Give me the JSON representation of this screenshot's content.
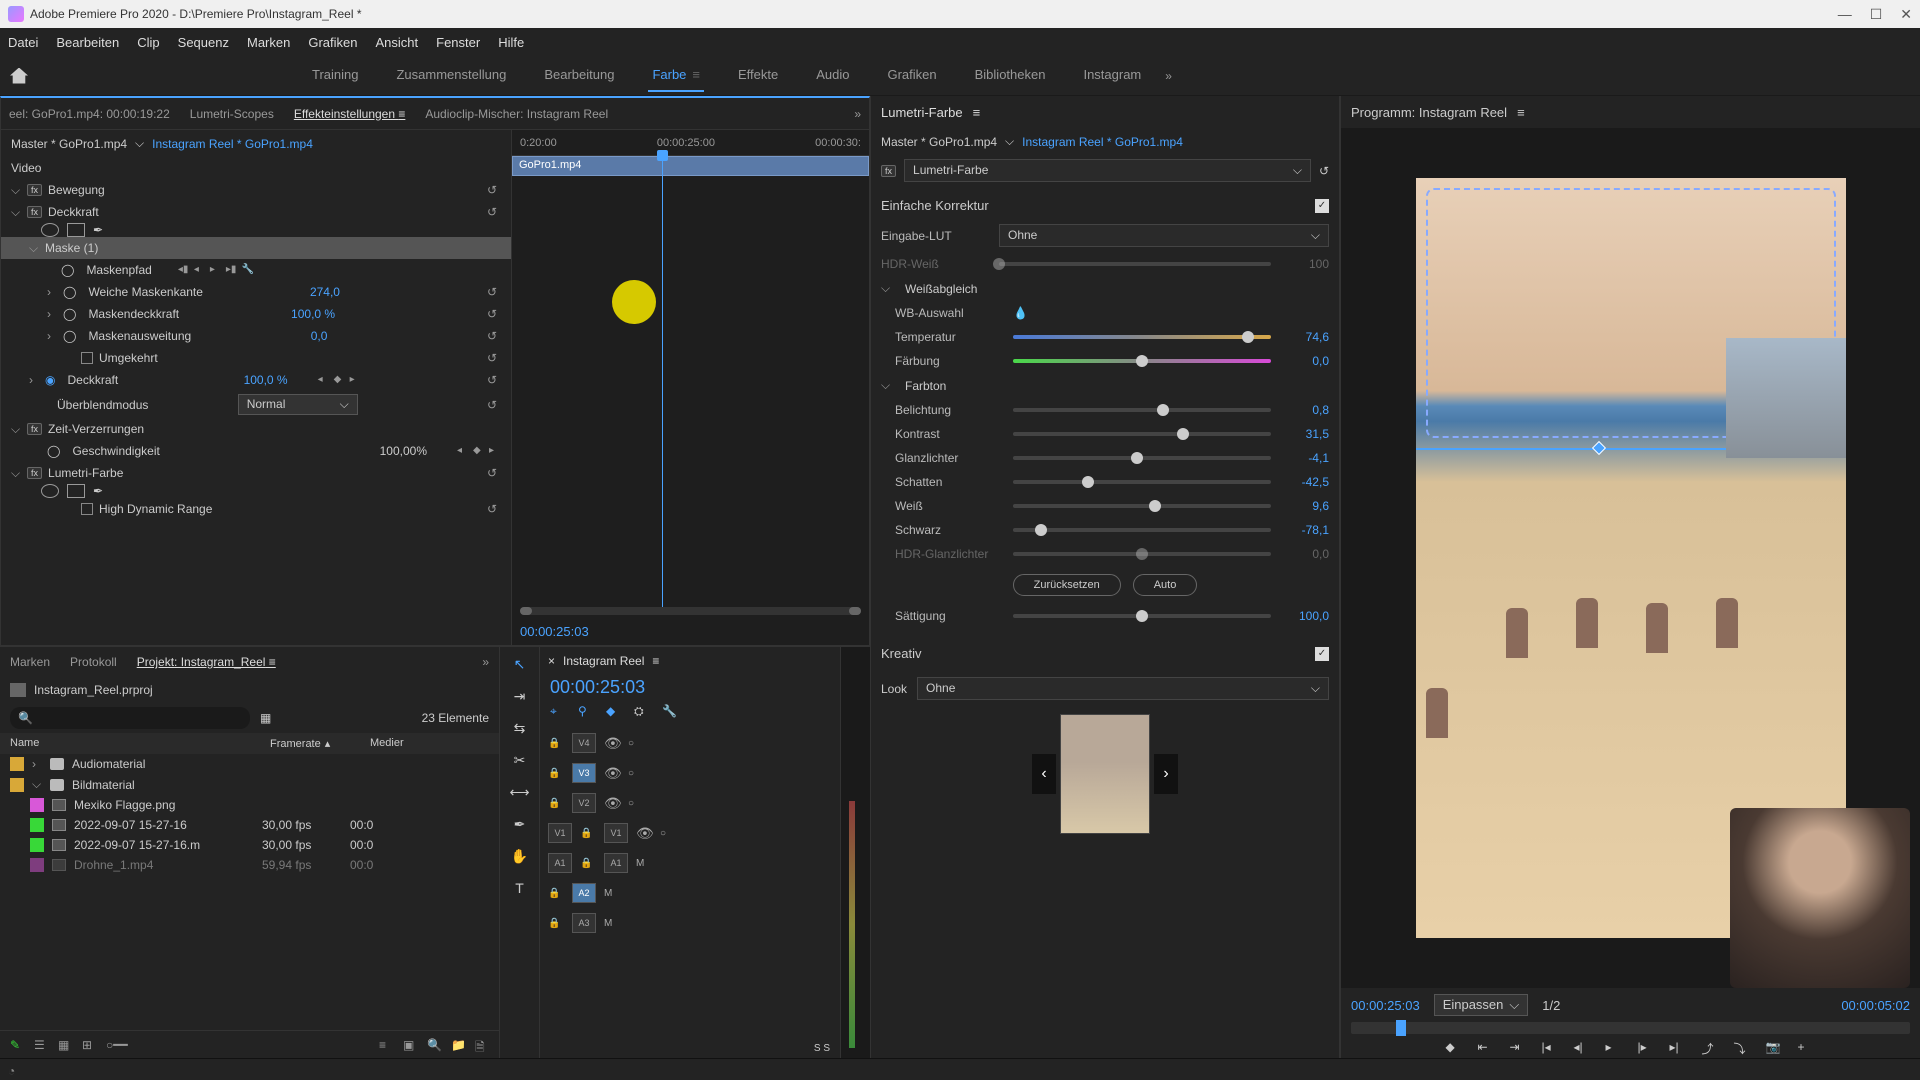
{
  "window": {
    "title": "Adobe Premiere Pro 2020 - D:\\Premiere Pro\\Instagram_Reel *"
  },
  "menu": [
    "Datei",
    "Bearbeiten",
    "Clip",
    "Sequenz",
    "Marken",
    "Grafiken",
    "Ansicht",
    "Fenster",
    "Hilfe"
  ],
  "workspaces": {
    "items": [
      "Training",
      "Zusammenstellung",
      "Bearbeitung",
      "Farbe",
      "Effekte",
      "Audio",
      "Grafiken",
      "Bibliotheken",
      "Instagram"
    ],
    "active": "Farbe"
  },
  "source_tabs": {
    "items": [
      "eel: GoPro1.mp4: 00:00:19:22",
      "Lumetri-Scopes",
      "Effekteinstellungen",
      "Audioclip-Mischer: Instagram Reel"
    ],
    "active": "Effekteinstellungen"
  },
  "effect_controls": {
    "master_label": "Master * GoPro1.mp4",
    "clip_link": "Instagram Reel * GoPro1.mp4",
    "video_label": "Video",
    "timeline_labels": [
      "0:20:00",
      "00:00:25:00",
      "00:00:30:"
    ],
    "clip_name": "GoPro1.mp4",
    "effects": {
      "bewegung": "Bewegung",
      "deckkraft": "Deckkraft",
      "maske": "Maske (1)",
      "maskenpfad": "Maskenpfad",
      "weiche": {
        "label": "Weiche Maskenkante",
        "value": "274,0"
      },
      "maskendeck": {
        "label": "Maskendeckkraft",
        "value": "100,0 %"
      },
      "maskenausw": {
        "label": "Maskenausweitung",
        "value": "0,0"
      },
      "umgekehrt": "Umgekehrt",
      "deckkraft2": {
        "label": "Deckkraft",
        "value": "100,0 %"
      },
      "blend": {
        "label": "Überblendmodus",
        "value": "Normal"
      },
      "zeit": "Zeit-Verzerrungen",
      "geschw": {
        "label": "Geschwindigkeit",
        "value": "100,00%"
      },
      "lumetri": "Lumetri-Farbe",
      "hdr": "High Dynamic Range"
    },
    "timecode": "00:00:25:03"
  },
  "project": {
    "tabs": [
      "Marken",
      "Protokoll",
      "Projekt: Instagram_Reel"
    ],
    "file": "Instagram_Reel.prproj",
    "count": "23 Elemente",
    "columns": [
      "Name",
      "Framerate",
      "Medier"
    ],
    "items": [
      {
        "color": "#d8a838",
        "type": "folder",
        "name": "Audiomaterial",
        "fr": "",
        "md": ""
      },
      {
        "color": "#d8a838",
        "type": "folder",
        "name": "Bildmaterial",
        "fr": "",
        "md": "",
        "open": true
      },
      {
        "color": "#d858d8",
        "type": "file",
        "name": "Mexiko Flagge.png",
        "fr": "",
        "md": ""
      },
      {
        "color": "#38d838",
        "type": "file",
        "name": "2022-09-07 15-27-16",
        "fr": "30,00 fps",
        "md": "00:0"
      },
      {
        "color": "#38d838",
        "type": "file",
        "name": "2022-09-07 15-27-16.m",
        "fr": "30,00 fps",
        "md": "00:0"
      },
      {
        "color": "#d858d8",
        "type": "file",
        "name": "Drohne_1.mp4",
        "fr": "59,94 fps",
        "md": "00:0"
      }
    ]
  },
  "timeline": {
    "seq_name": "Instagram Reel",
    "timecode": "00:00:25:03",
    "video_tracks": [
      {
        "tgt": "",
        "src": "V4"
      },
      {
        "tgt": "",
        "src": "V3",
        "active": true
      },
      {
        "tgt": "",
        "src": "V2"
      },
      {
        "tgt": "V1",
        "src": "V1"
      }
    ],
    "audio_tracks": [
      {
        "tgt": "A1",
        "src": "A1",
        "m": "M"
      },
      {
        "tgt": "",
        "src": "A2",
        "active": true,
        "m": "M"
      },
      {
        "tgt": "",
        "src": "A3",
        "m": "M"
      }
    ],
    "ss": "S  S"
  },
  "lumetri": {
    "title": "Lumetri-Farbe",
    "master": "Master * GoPro1.mp4",
    "clip": "Instagram Reel * GoPro1.mp4",
    "fx_name": "Lumetri-Farbe",
    "basic": {
      "title": "Einfache Korrektur",
      "lut_label": "Eingabe-LUT",
      "lut_value": "Ohne",
      "hdr_label": "HDR-Weiß",
      "hdr_value": "100",
      "wb_title": "Weißabgleich",
      "wb_pick": "WB-Auswahl",
      "temp": {
        "label": "Temperatur",
        "value": "74,6",
        "pos": 91
      },
      "tint": {
        "label": "Färbung",
        "value": "0,0",
        "pos": 50
      },
      "tone_title": "Farbton",
      "exposure": {
        "label": "Belichtung",
        "value": "0,8",
        "pos": 58
      },
      "contrast": {
        "label": "Kontrast",
        "value": "31,5",
        "pos": 66
      },
      "highlights": {
        "label": "Glanzlichter",
        "value": "-4,1",
        "pos": 48
      },
      "shadows": {
        "label": "Schatten",
        "value": "-42,5",
        "pos": 29
      },
      "whites": {
        "label": "Weiß",
        "value": "9,6",
        "pos": 55
      },
      "blacks": {
        "label": "Schwarz",
        "value": "-78,1",
        "pos": 11
      },
      "hdr_spec": {
        "label": "HDR-Glanzlichter",
        "value": "0,0",
        "pos": 50
      },
      "reset": "Zurücksetzen",
      "auto": "Auto",
      "sat": {
        "label": "Sättigung",
        "value": "100,0",
        "pos": 50
      }
    },
    "creative": {
      "title": "Kreativ",
      "look_label": "Look",
      "look_value": "Ohne"
    }
  },
  "program": {
    "title": "Programm: Instagram Reel",
    "timecode": "00:00:25:03",
    "fit": "Einpassen",
    "zoom": "1/2",
    "duration": "00:00:05:02"
  }
}
